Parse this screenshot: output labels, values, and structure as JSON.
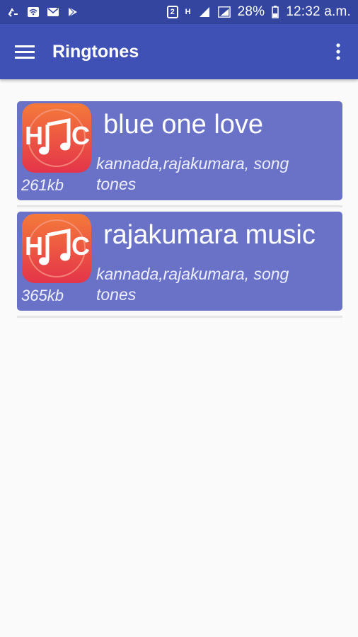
{
  "status_bar": {
    "battery": "28%",
    "time": "12:32 a.m.",
    "sim_badge": "2",
    "network": "H"
  },
  "app_bar": {
    "title": "Ringtones",
    "menu_icon": "hamburger-menu-icon",
    "overflow_icon": "more-vert-icon"
  },
  "ringtones": [
    {
      "title": "blue one love",
      "tags": "kannada,rajakumara, song tones",
      "size": "261kb",
      "logo_text": "HC"
    },
    {
      "title": "rajakumara music",
      "tags": "kannada,rajakumara, song tones",
      "size": "365kb",
      "logo_text": "HC"
    }
  ],
  "colors": {
    "status_bar": "#3445a0",
    "app_bar": "#3f51b5",
    "card": "#6a72c8",
    "logo_red": "#ea4a48",
    "background": "#fafafa"
  }
}
